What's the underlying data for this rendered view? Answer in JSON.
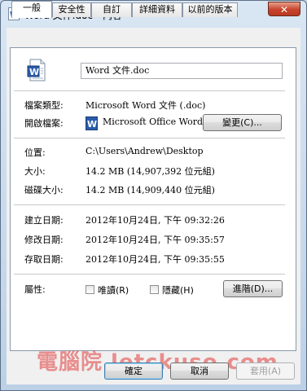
{
  "window": {
    "title": "Word 文件.doc - 內容",
    "close_glyph": "✕"
  },
  "tabs": [
    {
      "label": "一般",
      "active": true
    },
    {
      "label": "安全性"
    },
    {
      "label": "自訂"
    },
    {
      "label": "詳細資料"
    },
    {
      "label": "以前的版本"
    }
  ],
  "file": {
    "name": "Word 文件.doc",
    "icon": "word-document-icon"
  },
  "info": {
    "type_label": "檔案類型:",
    "type_value": "Microsoft Word 文件 (.doc)",
    "opens_label": "開啟檔案:",
    "opens_app": "Microsoft Office Word",
    "change_button": "變更(C)...",
    "location_label": "位置:",
    "location_value": "C:\\Users\\Andrew\\Desktop",
    "size_label": "大小:",
    "size_value": "14.2 MB (14,907,392 位元組)",
    "disk_size_label": "磁碟大小:",
    "disk_size_value": "14.2 MB (14,909,440 位元組)",
    "created_label": "建立日期:",
    "created_value": "2012年10月24日, 下午 09:32:26",
    "modified_label": "修改日期:",
    "modified_value": "2012年10月24日, 下午 09:35:57",
    "accessed_label": "存取日期:",
    "accessed_value": "2012年10月24日, 下午 09:35:55",
    "attributes_label": "屬性:",
    "readonly_label": "唯讀(R)",
    "hidden_label": "隱藏(H)",
    "advanced_button": "進階(D)..."
  },
  "footer": {
    "ok": "確定",
    "cancel": "取消",
    "apply": "套用(A)"
  },
  "watermark": "電腦院 letckuso.com"
}
